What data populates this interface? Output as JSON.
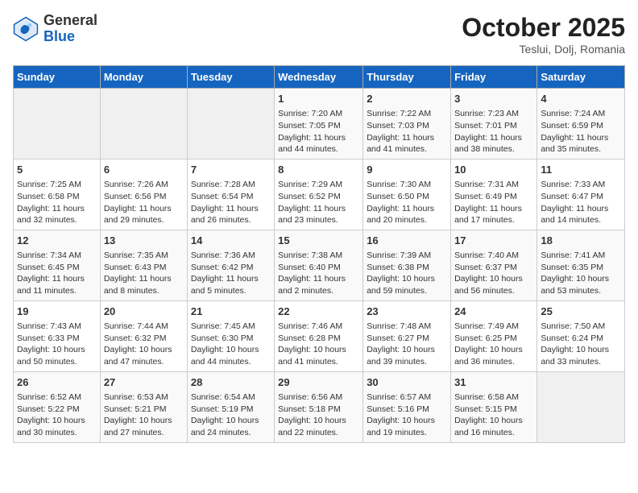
{
  "header": {
    "logo_line1": "General",
    "logo_line2": "Blue",
    "month": "October 2025",
    "location": "Teslui, Dolj, Romania"
  },
  "weekdays": [
    "Sunday",
    "Monday",
    "Tuesday",
    "Wednesday",
    "Thursday",
    "Friday",
    "Saturday"
  ],
  "weeks": [
    [
      {
        "day": "",
        "info": ""
      },
      {
        "day": "",
        "info": ""
      },
      {
        "day": "",
        "info": ""
      },
      {
        "day": "1",
        "info": "Sunrise: 7:20 AM\nSunset: 7:05 PM\nDaylight: 11 hours and 44 minutes."
      },
      {
        "day": "2",
        "info": "Sunrise: 7:22 AM\nSunset: 7:03 PM\nDaylight: 11 hours and 41 minutes."
      },
      {
        "day": "3",
        "info": "Sunrise: 7:23 AM\nSunset: 7:01 PM\nDaylight: 11 hours and 38 minutes."
      },
      {
        "day": "4",
        "info": "Sunrise: 7:24 AM\nSunset: 6:59 PM\nDaylight: 11 hours and 35 minutes."
      }
    ],
    [
      {
        "day": "5",
        "info": "Sunrise: 7:25 AM\nSunset: 6:58 PM\nDaylight: 11 hours and 32 minutes."
      },
      {
        "day": "6",
        "info": "Sunrise: 7:26 AM\nSunset: 6:56 PM\nDaylight: 11 hours and 29 minutes."
      },
      {
        "day": "7",
        "info": "Sunrise: 7:28 AM\nSunset: 6:54 PM\nDaylight: 11 hours and 26 minutes."
      },
      {
        "day": "8",
        "info": "Sunrise: 7:29 AM\nSunset: 6:52 PM\nDaylight: 11 hours and 23 minutes."
      },
      {
        "day": "9",
        "info": "Sunrise: 7:30 AM\nSunset: 6:50 PM\nDaylight: 11 hours and 20 minutes."
      },
      {
        "day": "10",
        "info": "Sunrise: 7:31 AM\nSunset: 6:49 PM\nDaylight: 11 hours and 17 minutes."
      },
      {
        "day": "11",
        "info": "Sunrise: 7:33 AM\nSunset: 6:47 PM\nDaylight: 11 hours and 14 minutes."
      }
    ],
    [
      {
        "day": "12",
        "info": "Sunrise: 7:34 AM\nSunset: 6:45 PM\nDaylight: 11 hours and 11 minutes."
      },
      {
        "day": "13",
        "info": "Sunrise: 7:35 AM\nSunset: 6:43 PM\nDaylight: 11 hours and 8 minutes."
      },
      {
        "day": "14",
        "info": "Sunrise: 7:36 AM\nSunset: 6:42 PM\nDaylight: 11 hours and 5 minutes."
      },
      {
        "day": "15",
        "info": "Sunrise: 7:38 AM\nSunset: 6:40 PM\nDaylight: 11 hours and 2 minutes."
      },
      {
        "day": "16",
        "info": "Sunrise: 7:39 AM\nSunset: 6:38 PM\nDaylight: 10 hours and 59 minutes."
      },
      {
        "day": "17",
        "info": "Sunrise: 7:40 AM\nSunset: 6:37 PM\nDaylight: 10 hours and 56 minutes."
      },
      {
        "day": "18",
        "info": "Sunrise: 7:41 AM\nSunset: 6:35 PM\nDaylight: 10 hours and 53 minutes."
      }
    ],
    [
      {
        "day": "19",
        "info": "Sunrise: 7:43 AM\nSunset: 6:33 PM\nDaylight: 10 hours and 50 minutes."
      },
      {
        "day": "20",
        "info": "Sunrise: 7:44 AM\nSunset: 6:32 PM\nDaylight: 10 hours and 47 minutes."
      },
      {
        "day": "21",
        "info": "Sunrise: 7:45 AM\nSunset: 6:30 PM\nDaylight: 10 hours and 44 minutes."
      },
      {
        "day": "22",
        "info": "Sunrise: 7:46 AM\nSunset: 6:28 PM\nDaylight: 10 hours and 41 minutes."
      },
      {
        "day": "23",
        "info": "Sunrise: 7:48 AM\nSunset: 6:27 PM\nDaylight: 10 hours and 39 minutes."
      },
      {
        "day": "24",
        "info": "Sunrise: 7:49 AM\nSunset: 6:25 PM\nDaylight: 10 hours and 36 minutes."
      },
      {
        "day": "25",
        "info": "Sunrise: 7:50 AM\nSunset: 6:24 PM\nDaylight: 10 hours and 33 minutes."
      }
    ],
    [
      {
        "day": "26",
        "info": "Sunrise: 6:52 AM\nSunset: 5:22 PM\nDaylight: 10 hours and 30 minutes."
      },
      {
        "day": "27",
        "info": "Sunrise: 6:53 AM\nSunset: 5:21 PM\nDaylight: 10 hours and 27 minutes."
      },
      {
        "day": "28",
        "info": "Sunrise: 6:54 AM\nSunset: 5:19 PM\nDaylight: 10 hours and 24 minutes."
      },
      {
        "day": "29",
        "info": "Sunrise: 6:56 AM\nSunset: 5:18 PM\nDaylight: 10 hours and 22 minutes."
      },
      {
        "day": "30",
        "info": "Sunrise: 6:57 AM\nSunset: 5:16 PM\nDaylight: 10 hours and 19 minutes."
      },
      {
        "day": "31",
        "info": "Sunrise: 6:58 AM\nSunset: 5:15 PM\nDaylight: 10 hours and 16 minutes."
      },
      {
        "day": "",
        "info": ""
      }
    ]
  ]
}
